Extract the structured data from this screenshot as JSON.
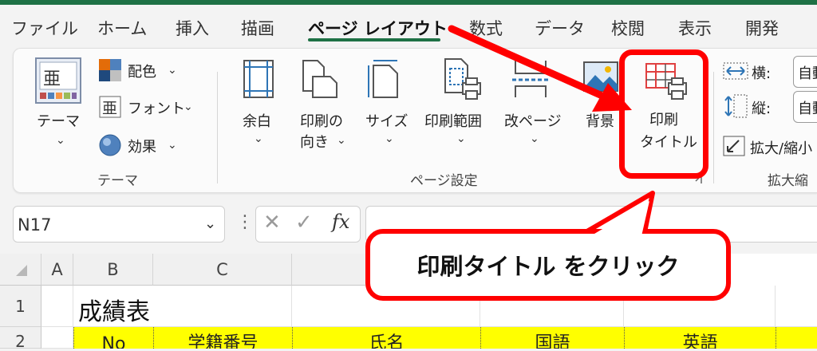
{
  "menu": {
    "tabs": [
      "ファイル",
      "ホーム",
      "挿入",
      "描画",
      "ページ レイアウト",
      "数式",
      "データ",
      "校閲",
      "表示",
      "開発"
    ],
    "active": "ページ レイアウト"
  },
  "ribbon": {
    "themes": {
      "theme_label": "テーマ",
      "colors_label": "配色",
      "fonts_label": "フォント",
      "effects_label": "効果",
      "group_label": "テーマ"
    },
    "page_setup": {
      "margins_label": "余白",
      "orientation_label_1": "印刷の",
      "orientation_label_2": "向き",
      "size_label": "サイズ",
      "print_area_label": "印刷範囲",
      "breaks_label": "改ページ",
      "background_label": "背景",
      "print_titles_label_1": "印刷",
      "print_titles_label_2": "タイトル",
      "group_label": "ページ設定"
    },
    "scale": {
      "width_label": "横:",
      "height_label": "縦:",
      "scale_label": "拡大/縮小",
      "width_value": "自動",
      "height_value": "自動",
      "group_label": "拡大縮"
    }
  },
  "formula_bar": {
    "name_box": "N17",
    "fx": "fx"
  },
  "sheet": {
    "columns": [
      "A",
      "B",
      "C"
    ],
    "rows": [
      "1",
      "2"
    ],
    "title": "成績表",
    "headers": [
      "No",
      "学籍番号",
      "氏名",
      "国語",
      "英語"
    ]
  },
  "annotation": {
    "callout_text": "印刷タイトル をクリック"
  },
  "colors": {
    "accent": "#1e7145",
    "callout": "#ff0000",
    "header_fill": "#ffff00"
  }
}
